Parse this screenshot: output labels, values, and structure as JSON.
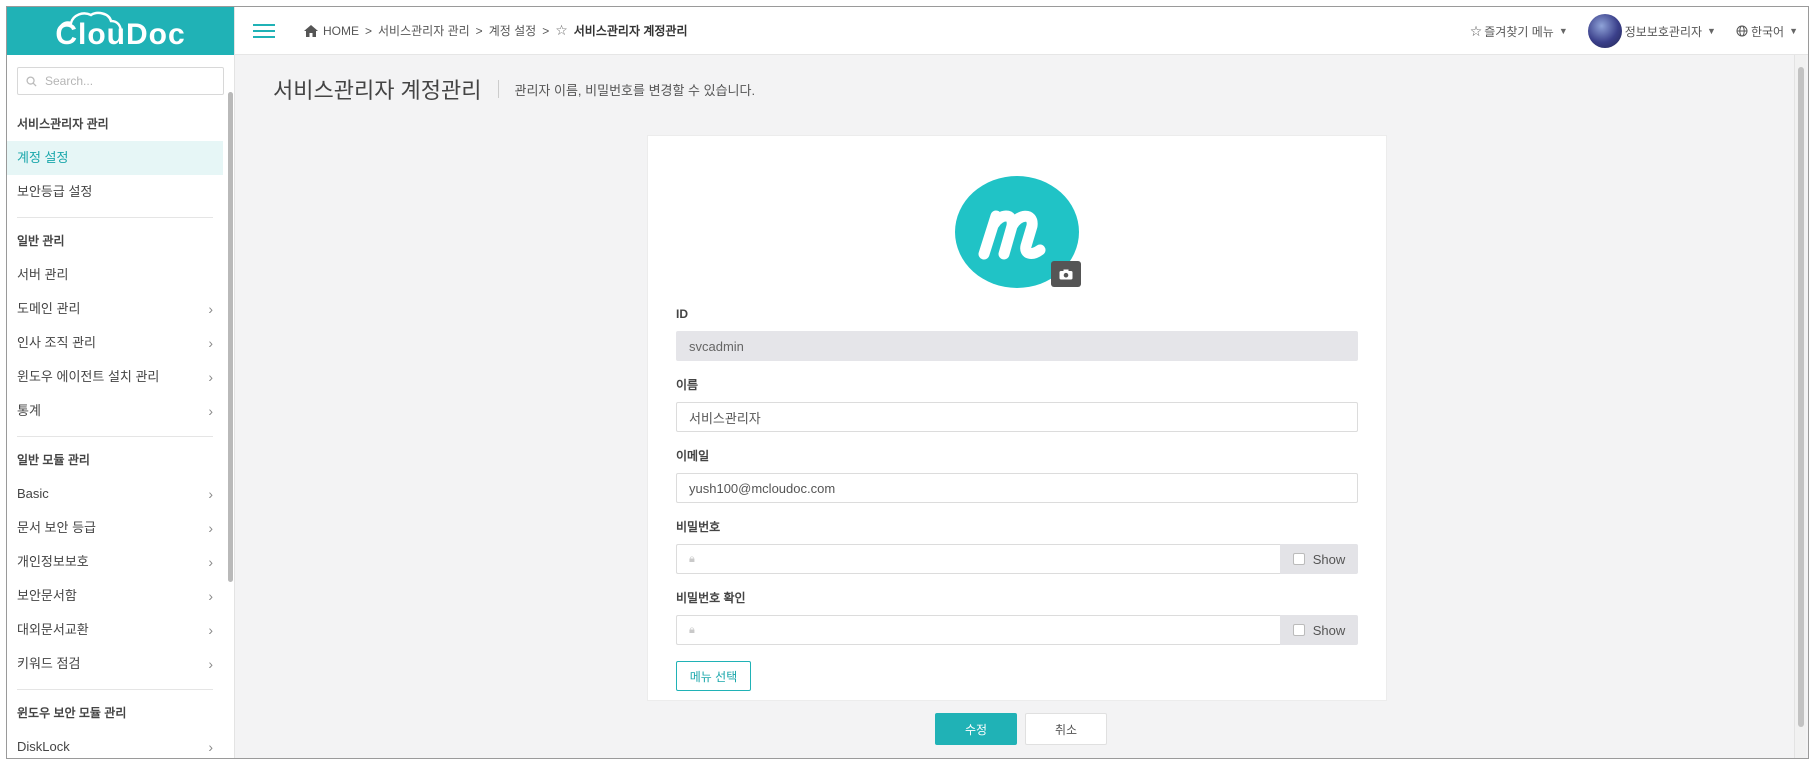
{
  "app": {
    "logo": "ClouDoc"
  },
  "sidebar": {
    "search_placeholder": "Search...",
    "sections": [
      {
        "title": "서비스관리자 관리",
        "items": [
          {
            "label": "계정 설정",
            "active": true,
            "arrow": false
          },
          {
            "label": "보안등급 설정",
            "arrow": false
          }
        ]
      },
      {
        "title": "일반 관리",
        "items": [
          {
            "label": "서버 관리",
            "arrow": false
          },
          {
            "label": "도메인 관리",
            "arrow": true
          },
          {
            "label": "인사 조직 관리",
            "arrow": true
          },
          {
            "label": "윈도우 에이전트 설치 관리",
            "arrow": true
          },
          {
            "label": "통계",
            "arrow": true
          }
        ]
      },
      {
        "title": "일반 모듈 관리",
        "items": [
          {
            "label": "Basic",
            "arrow": true
          },
          {
            "label": "문서 보안 등급",
            "arrow": true
          },
          {
            "label": "개인정보보호",
            "arrow": true
          },
          {
            "label": "보안문서함",
            "arrow": true
          },
          {
            "label": "대외문서교환",
            "arrow": true
          },
          {
            "label": "키워드 점검",
            "arrow": true
          }
        ]
      },
      {
        "title": "윈도우 보안 모듈 관리",
        "items": [
          {
            "label": "DiskLock",
            "arrow": true
          }
        ]
      }
    ]
  },
  "header": {
    "breadcrumb": {
      "home": "HOME",
      "sep": ">",
      "level1": "서비스관리자 관리",
      "level2": "계정 설정",
      "current": "서비스관리자 계정관리"
    },
    "favorites": "즐겨찾기 메뉴",
    "user": "정보보호관리자",
    "language": "한국어"
  },
  "page": {
    "title": "서비스관리자 계정관리",
    "description": "관리자 이름, 비밀번호를 변경할 수 있습니다."
  },
  "form": {
    "id_label": "ID",
    "id_value": "svcadmin",
    "name_label": "이름",
    "name_value": "서비스관리자",
    "email_label": "이메일",
    "email_value": "yush100@mcloudoc.com",
    "password_label": "비밀번호",
    "password_confirm_label": "비밀번호 확인",
    "show_label": "Show",
    "menu_select": "메뉴 선택"
  },
  "actions": {
    "submit": "수정",
    "cancel": "취소"
  },
  "colors": {
    "accent": "#20b2b6",
    "avatar": "#20c3c6"
  },
  "icons": [
    "home-icon",
    "star-icon",
    "hamburger-icon",
    "globe-icon",
    "search-icon",
    "camera-icon",
    "lock-icon",
    "chevron-right-icon"
  ]
}
